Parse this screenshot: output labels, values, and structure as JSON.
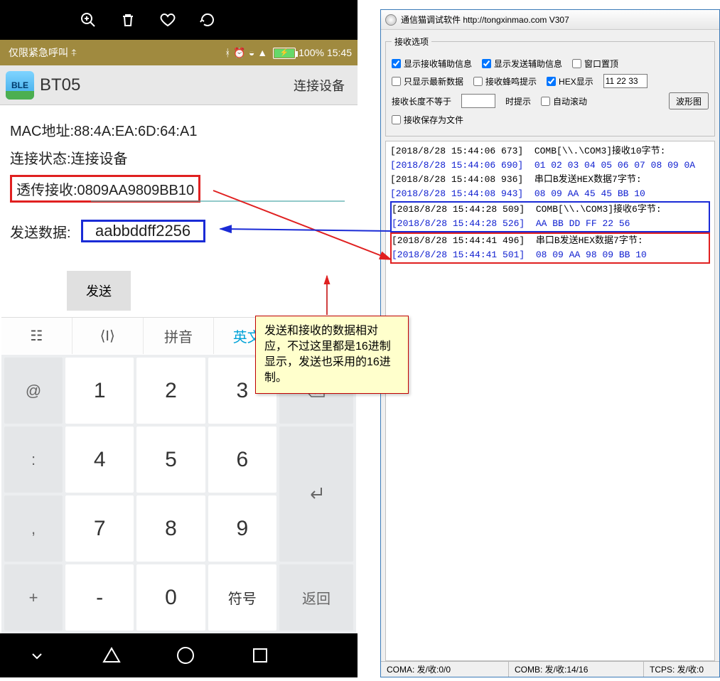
{
  "phone": {
    "status": {
      "carrier": "仅限紧急呼叫",
      "battery": "100%",
      "time": "15:45"
    },
    "app": {
      "badge": "BLE",
      "title": "BT05",
      "connect_btn": "连接设备",
      "mac_label": "MAC地址:88:4A:EA:6D:64:A1",
      "conn_state": "连接状态:连接设备",
      "recv_label": "透传接收:0809AA9809BB10",
      "send_label": "发送数据:",
      "send_value": "aabbddff2256",
      "send_btn": "发送"
    },
    "ime": {
      "tabs": [
        "拼音",
        "英文"
      ],
      "keys_side_left": [
        "@",
        ":",
        ",",
        "+"
      ],
      "keys_num": [
        "1",
        "2",
        "3",
        "4",
        "5",
        "6",
        "7",
        "8",
        "9",
        "",
        "0",
        ""
      ],
      "key_symbol": "符号",
      "key_return": "返回",
      "key_dash": "-"
    }
  },
  "win": {
    "title": "通信猫调试软件  http://tongxinmao.com  V307",
    "groupbox": "接收选项",
    "opts": {
      "show_recv_aux": "显示接收辅助信息",
      "show_send_aux": "显示发送辅助信息",
      "topmost": "窗口置顶",
      "show_latest": "只显示最新数据",
      "beep": "接收蜂鸣提示",
      "hex_disp": "HEX显示",
      "hex_value": "11 22 33",
      "len_neq": "接收长度不等于",
      "len_hint": "时提示",
      "autoscroll": "自动滚动",
      "wave_btn": "波形图",
      "save_file": "接收保存为文件"
    },
    "log": [
      {
        "cls": "",
        "t": "[2018/8/28 15:44:06 673]  COMB[\\\\.\\COM3]接收10字节:"
      },
      {
        "cls": "blue",
        "t": "[2018/8/28 15:44:06 690]  01 02 03 04 05 06 07 08 09 0A "
      },
      {
        "cls": "",
        "t": "[2018/8/28 15:44:08 936]  串口B发送HEX数据7字节:"
      },
      {
        "cls": "blue",
        "t": "[2018/8/28 15:44:08 943]  08 09 AA 45 45 BB 10 "
      },
      {
        "cls": "box-blue-start",
        "t": ""
      },
      {
        "cls": "",
        "t": "[2018/8/28 15:44:28 509]  COMB[\\\\.\\COM3]接收6字节:"
      },
      {
        "cls": "blue",
        "t": "[2018/8/28 15:44:28 526]  AA BB DD FF 22 56 "
      },
      {
        "cls": "box-blue-end",
        "t": ""
      },
      {
        "cls": "box-red-start",
        "t": ""
      },
      {
        "cls": "",
        "t": "[2018/8/28 15:44:41 496]  串口B发送HEX数据7字节:"
      },
      {
        "cls": "blue",
        "t": "[2018/8/28 15:44:41 501]  08 09 AA 98 09 BB 10 "
      },
      {
        "cls": "box-red-end",
        "t": ""
      }
    ],
    "status": {
      "a": "COMA: 发/收:0/0",
      "b": "COMB: 发/收:14/16",
      "t": "TCPS: 发/收:0"
    }
  },
  "annotation": "发送和接收的数据相对应，不过这里都是16进制显示，发送也采用的16进制。"
}
